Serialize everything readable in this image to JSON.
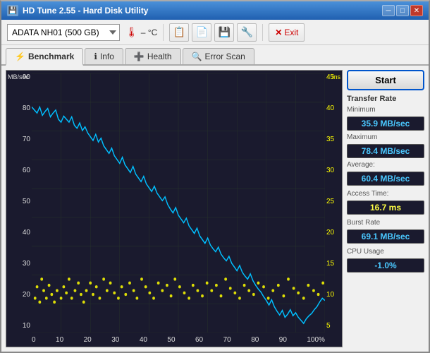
{
  "window": {
    "title": "HD Tune 2.55 - Hard Disk Utility",
    "min_btn": "─",
    "max_btn": "□",
    "close_btn": "✕"
  },
  "toolbar": {
    "drive_value": "ADATA  NH01 (500 GB)",
    "temp_icon": "🌡",
    "temp_value": "– °C",
    "icon1": "📋",
    "icon2": "📋",
    "icon3": "💾",
    "icon4": "🔧",
    "exit_label": "Exit"
  },
  "tabs": [
    {
      "id": "benchmark",
      "label": "Benchmark",
      "icon": "⚡",
      "active": true
    },
    {
      "id": "info",
      "label": "Info",
      "icon": "ℹ"
    },
    {
      "id": "health",
      "label": "Health",
      "icon": "➕"
    },
    {
      "id": "error-scan",
      "label": "Error Scan",
      "icon": "🔍"
    }
  ],
  "chart": {
    "y_unit_left": "MB/sec",
    "y_unit_right": "ms",
    "y_labels_left": [
      "90",
      "80",
      "70",
      "60",
      "50",
      "40",
      "30",
      "20",
      "10"
    ],
    "y_labels_right": [
      "45",
      "40",
      "35",
      "30",
      "25",
      "20",
      "15",
      "10",
      "5"
    ],
    "x_labels": [
      "0",
      "10",
      "20",
      "30",
      "40",
      "50",
      "60",
      "70",
      "80",
      "90",
      "100%"
    ]
  },
  "sidebar": {
    "start_label": "Start",
    "transfer_rate_title": "Transfer Rate",
    "minimum_label": "Minimum",
    "minimum_value": "35.9 MB/sec",
    "maximum_label": "Maximum",
    "maximum_value": "78.4 MB/sec",
    "average_label": "Average:",
    "average_value": "60.4 MB/sec",
    "access_time_label": "Access Time:",
    "access_time_value": "16.7 ms",
    "burst_rate_label": "Burst Rate",
    "burst_rate_value": "69.1 MB/sec",
    "cpu_usage_label": "CPU Usage",
    "cpu_usage_value": "-1.0%"
  },
  "colors": {
    "line_color": "#00bfff",
    "scatter_color": "#ffff00",
    "grid_color": "#2a2a4a",
    "bg_color": "#111122"
  }
}
